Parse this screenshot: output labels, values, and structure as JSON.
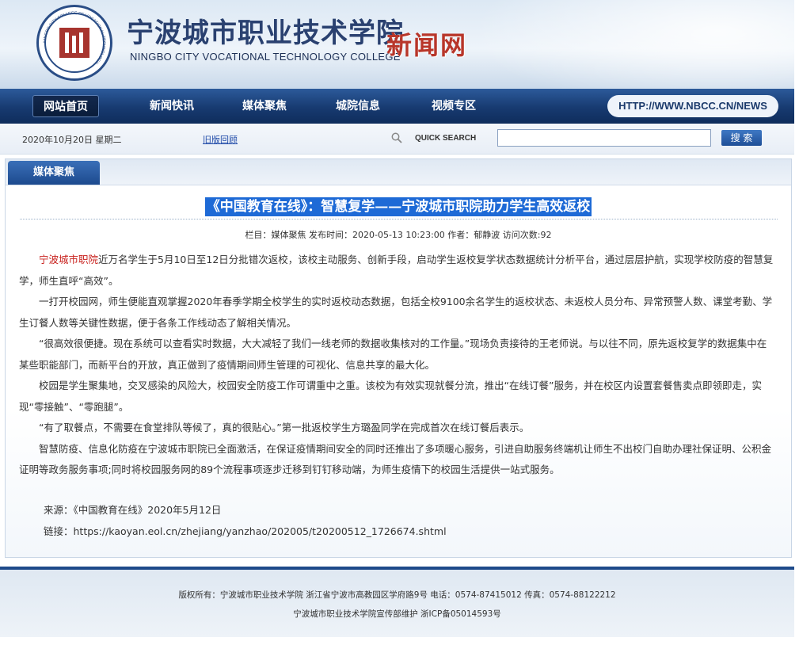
{
  "header": {
    "title_cn": "宁波城市职业技术学院",
    "title_en": "NINGBO CITY VOCATIONAL TECHNOLOGY COLLEGE",
    "site_label": "新闻网",
    "logo_ring_text": "NINGBO CITY COLLEGE OF VOCATIONAL TECHNOLOGY"
  },
  "nav": {
    "items": [
      "网站首页",
      "新闻快讯",
      "媒体聚焦",
      "城院信息",
      "视频专区"
    ],
    "url": "HTTP://WWW.NBCC.CN/NEWS"
  },
  "searchbar": {
    "date": "2020年10月20日  星期二",
    "old_version": "旧版回顾",
    "quick_search_label": "QUICK SEARCH",
    "search_value": "",
    "search_button": "搜 索"
  },
  "panel": {
    "tab": "媒体聚焦"
  },
  "article": {
    "title": "《中国教育在线》：智慧复学——宁波城市职院助力学生高效返校",
    "meta": "栏目：媒体聚焦   发布时间：2020-05-13 10:23:00   作者：郁静波   访问次数:92",
    "p1_highlight": "宁波城市职院",
    "p1": "近万名学生于5月10日至12日分批错次返校，该校主动服务、创新手段，启动学生返校复学状态数据统计分析平台，通过层层护航，实现学校防疫的智慧复学，师生直呼“高效”。",
    "p2": "一打开校园网，师生便能直观掌握2020年春季学期全校学生的实时返校动态数据，包括全校9100余名学生的返校状态、未返校人员分布、异常预警人数、课堂考勤、学生订餐人数等关键性数据，便于各条工作线动态了解相关情况。",
    "p3": "“很高效很便捷。现在系统可以查看实时数据，大大减轻了我们一线老师的数据收集核对的工作量。”现场负责接待的王老师说。与以往不同，原先返校复学的数据集中在某些职能部门，而新平台的开放，真正做到了疫情期间师生管理的可视化、信息共享的最大化。",
    "p4": "校园是学生聚集地，交叉感染的风险大，校园安全防疫工作可谓重中之重。该校为有效实现就餐分流，推出“在线订餐”服务，并在校区内设置套餐售卖点即领即走，实现“零接触”、“零跑腿”。",
    "p5": "“有了取餐点，不需要在食堂排队等候了，真的很贴心。”第一批返校学生方璐盈同学在完成首次在线订餐后表示。",
    "p6": "智慧防疫、信息化防疫在宁波城市职院已全面激活，在保证疫情期间安全的同时还推出了多项暖心服务，引进自助服务终端机让师生不出校门自助办理社保证明、公积金证明等政务服务事项;同时将校园服务网的89个流程事项逐步迁移到钉钉移动端，为师生疫情下的校园生活提供一站式服务。",
    "source": "来源：《中国教育在线》2020年5月12日",
    "link": "链接：https://kaoyan.eol.cn/zhejiang/yanzhao/202005/t20200512_1726674.shtml"
  },
  "footer": {
    "line1": "版权所有：宁波城市职业技术学院 浙江省宁波市高教园区学府路9号 电话：0574-87415012 传真：0574-88122212",
    "line2": "宁波城市职业技术学院宣传部维护 浙ICP备05014593号"
  },
  "colors": {
    "nav_dark": "#173a70",
    "accent_red": "#c8201c",
    "title_highlight": "#1e6ad6",
    "link_blue": "#1f4aa8"
  }
}
